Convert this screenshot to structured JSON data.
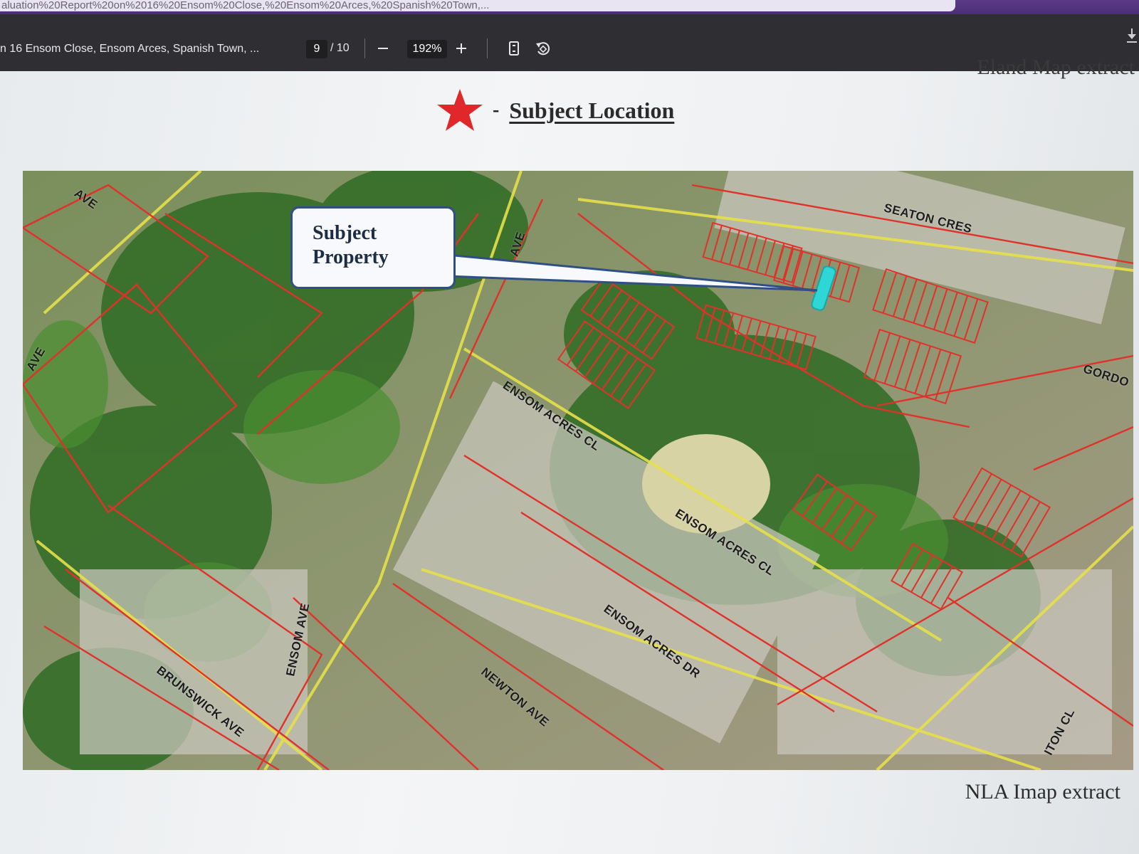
{
  "browser": {
    "url_fragment": "aluation%20Report%20on%2016%20Ensom%20Close,%20Ensom%20Arces,%20Spanish%20Town,..."
  },
  "toolbar": {
    "doc_title": "n 16 Ensom Close, Ensom Arces, Spanish Town, ...",
    "current_page": "9",
    "total_pages": "/ 10",
    "zoom": "192%",
    "zoom_out_icon": "minus-icon",
    "zoom_in_icon": "plus-icon",
    "fit_page_icon": "fit-page-icon",
    "rotate_icon": "rotate-icon",
    "download_icon": "download-icon"
  },
  "page": {
    "eland_caption": "Eland Map extract",
    "legend_label": "Subject Location",
    "legend_dash": "-",
    "nla_caption": "NLA Imap extract",
    "callout_line1": "Subject",
    "callout_line2": "Property"
  },
  "map": {
    "streets": [
      "AVE",
      "AVE",
      "AVE",
      "SEATON CRES",
      "GORDO",
      "ENSOM ACRES CL",
      "ENSOM ACRES CL",
      "ENSOM ACRES DR",
      "ENSOM AVE",
      "NEWTON AVE",
      "BRUNSWICK AVE",
      "ITON CL"
    ],
    "colors": {
      "parcel_lines": "#e0322a",
      "road_lines": "#e6e04a",
      "subject_highlight": "#2fd6d6",
      "star": "#e0282a",
      "callout_border": "#2f4f86"
    }
  }
}
